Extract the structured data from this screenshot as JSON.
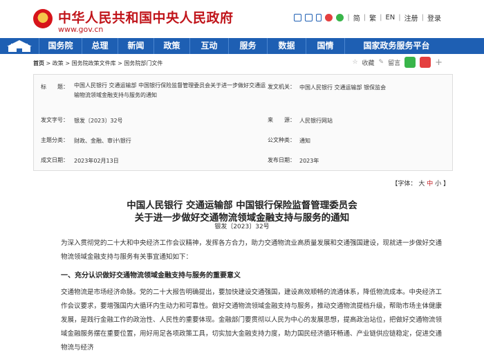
{
  "header": {
    "site_title": "中华人民共和国中央人民政府",
    "site_url": "www.gov.cn",
    "top_links": [
      "简",
      "繁",
      "EN",
      "注册",
      "登录"
    ],
    "top_sep": "|"
  },
  "nav": {
    "items": [
      "国务院",
      "总理",
      "新闻",
      "政策",
      "互动",
      "服务",
      "数据",
      "国情",
      "国家政务服务平台"
    ]
  },
  "breadcrumb": {
    "items": [
      "首页",
      "政策",
      "国务院政策文件库",
      "国务院部门文件"
    ],
    "sep": " > "
  },
  "actions": {
    "favorite": "收藏",
    "comment": "留言",
    "more": "+"
  },
  "meta": {
    "title_label": "标　　题：",
    "title_value": "中国人民银行 交通运输部 中国银行保险监督管理委员会关于进一步做好交通运输物流领域金融支持与服务的通知",
    "issuer_label": "发文机关：",
    "issuer_value": "中国人民银行 交通运输部 银保监会",
    "doc_no_label": "发文字号：",
    "doc_no_value": "银发〔2023〕32号",
    "source_label": "来　　源：",
    "source_value": "人民银行网站",
    "topic_label": "主题分类：",
    "topic_value": "财政、金融、审计\\银行",
    "type_label": "公文种类：",
    "type_value": "通知",
    "written_label": "成文日期：",
    "written_value": "2023年02月13日",
    "published_label": "发布日期：",
    "published_value": "2023年"
  },
  "font_size": {
    "label": "【字体：",
    "big": "大",
    "mid": "中",
    "small": "小",
    "close": "】"
  },
  "document": {
    "title_line1": "中国人民银行 交通运输部 中国银行保险监督管理委员会",
    "title_line2": "关于进一步做好交通物流领域金融支持与服务的通知",
    "doc_no": "银发〔2023〕32号",
    "intro": "为深入贯彻党的二十大和中央经济工作会议精神，发挥各方合力，助力交通物流业高质量发展和交通强国建设，现就进一步做好交通物流领域金融支持与服务有关事宜通知如下：",
    "section1": "一、充分认识做好交通物流领域金融支持与服务的重要意义",
    "body": "交通物流是市场经济命脉。党的二十大报告明确提出，要加快建设交通强国，建设高效顺畅的流通体系，降低物流成本。中央经济工作会议要求，要增强国内大循环内生动力和可靠性。做好交通物流领域金融支持与服务，推动交通物流提档升级，帮助市场主体健康发展，是践行金融工作的政治性、人民性的重要体现。金融部门要贯彻以人民为中心的发展思想，提高政治站位，把做好交通物流领域金融服务摆在重要位置，用好用足各项政策工具，切实加大金融支持力度，助力国民经济循环畅通、产业链供应链稳定，促进交通物流与经济"
  },
  "colors": {
    "brand_red": "#c0141a",
    "nav_blue": "#1e5fb3"
  }
}
